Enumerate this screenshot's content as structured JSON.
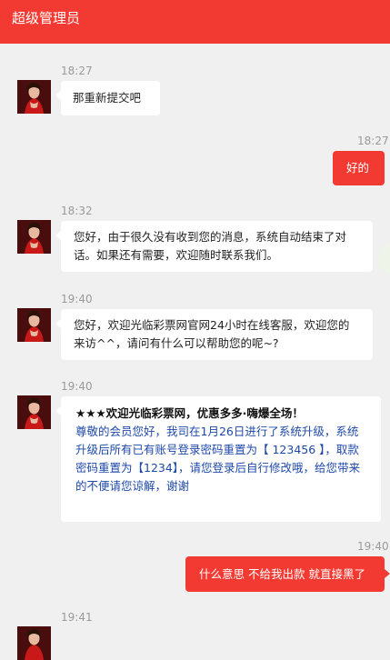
{
  "header": {
    "title": "超级管理员"
  },
  "colors": {
    "accent": "#f33a32",
    "notice_text": "#1f49a8"
  },
  "messages": [
    {
      "time": "18:27",
      "from": "agent",
      "text": "那重新提交吧"
    },
    {
      "time": "18:27",
      "from": "user",
      "text": "好的"
    },
    {
      "time": "18:32",
      "from": "agent",
      "text": "您好，由于很久没有收到您的消息，系统自动结束了对话。如果还有需要，欢迎随时联系我们。"
    },
    {
      "time": "19:40",
      "from": "agent",
      "text": "您好，欢迎光临彩票网官网24小时在线客服，欢迎您的来访^^，请问有什么可以帮助您的呢~?"
    },
    {
      "time": "19:40",
      "from": "agent",
      "title": "★★★欢迎光临彩票网，优惠多多·嗨爆全场！",
      "text": "尊敬的会员您好，我司在1月26日进行了系统升级，系统升级后所有已有账号登录密码重置为【 123456 】，取款密码重置为【1234】，请您登录后自行修改哦，给您带来的不便请您谅解，谢谢"
    },
    {
      "time": "19:40",
      "from": "user",
      "text": "什么意思 不给我出款 就直接黑了"
    },
    {
      "time": "19:41",
      "from": "agent",
      "text": ""
    }
  ]
}
